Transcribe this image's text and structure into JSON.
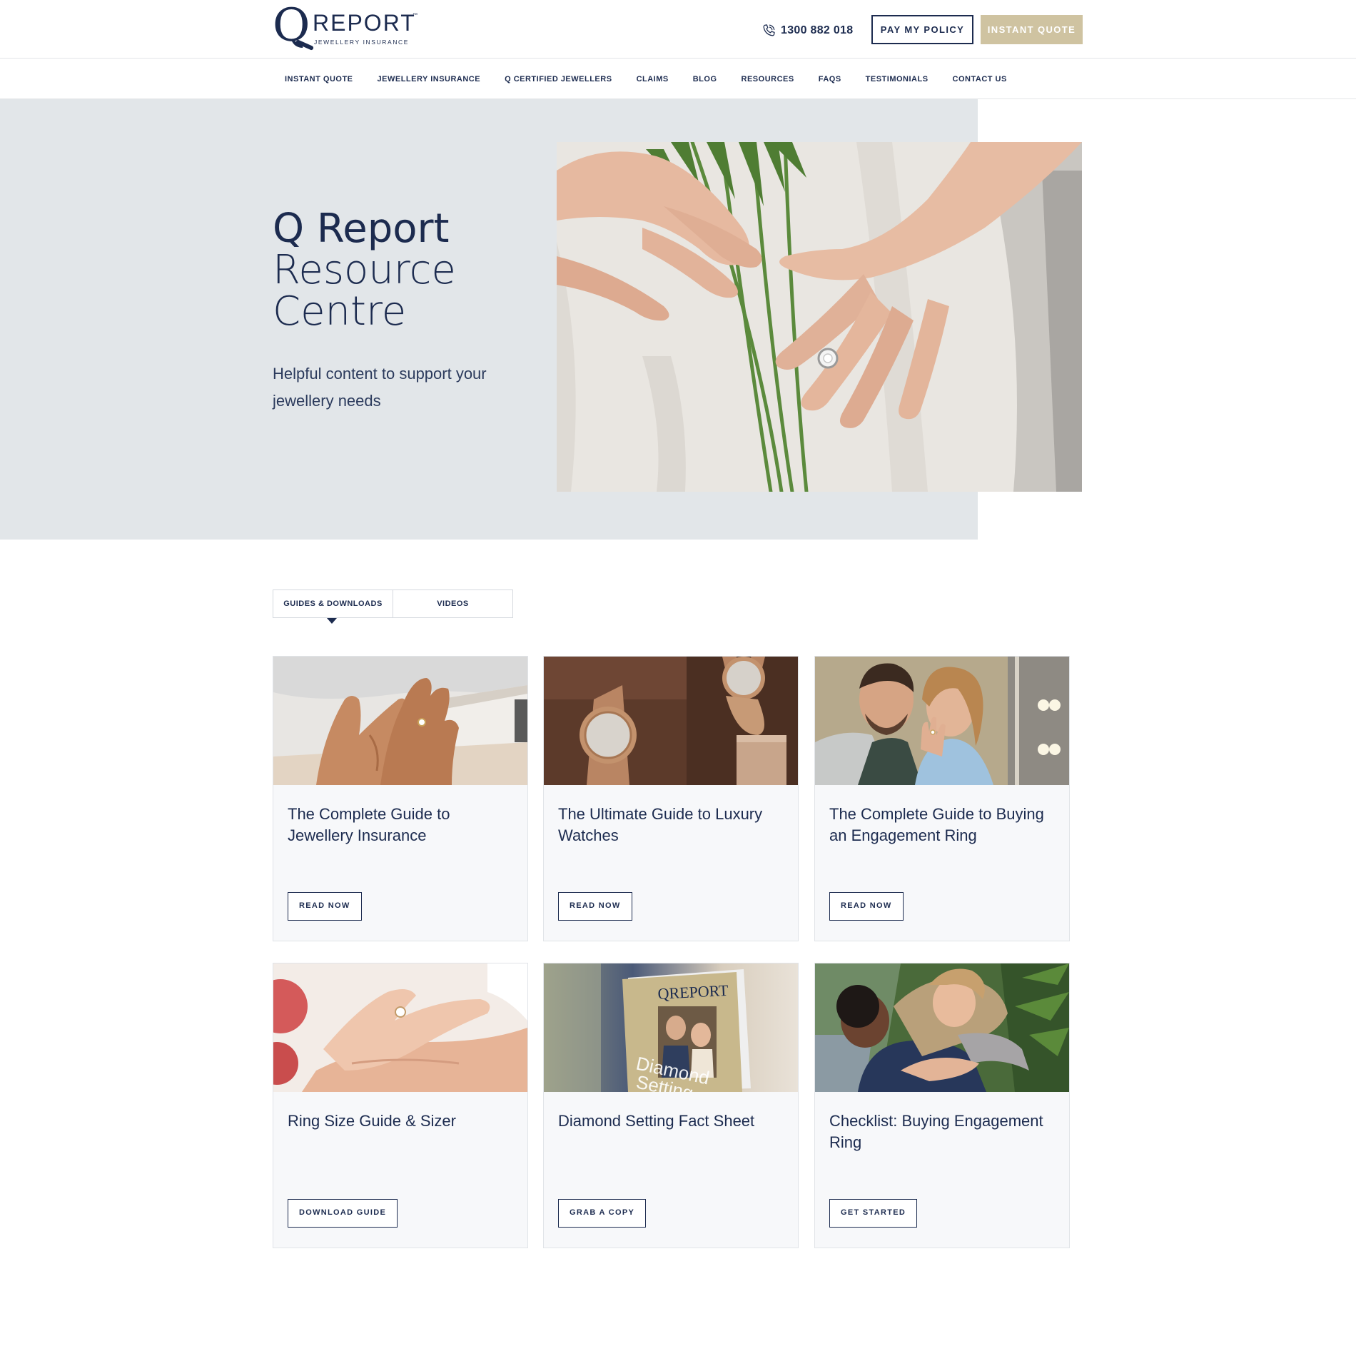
{
  "brand": {
    "logo_letter": "Q",
    "logo_word": "REPORT",
    "logo_tm": "™",
    "logo_sub": "JEWELLERY INSURANCE",
    "navy": "#1c2b4f",
    "gold": "#cfc3a1",
    "hero_bg": "#e2e6e9"
  },
  "header": {
    "phone": "1300 882 018",
    "phone_icon": "phone-icon",
    "pay_label": "PAY MY POLICY",
    "quote_label": "INSTANT QUOTE"
  },
  "nav": {
    "items": [
      "INSTANT QUOTE",
      "JEWELLERY INSURANCE",
      "Q CERTIFIED JEWELLERS",
      "CLAIMS",
      "BLOG",
      "RESOURCES",
      "FAQS",
      "TESTIMONIALS",
      "CONTACT US"
    ]
  },
  "hero": {
    "title_line1": "Q Report",
    "title_line2": "Resource",
    "title_line3": "Centre",
    "subtitle": "Helpful content to support your jewellery needs"
  },
  "tabs": {
    "items": [
      "GUIDES & DOWNLOADS",
      "VIDEOS"
    ],
    "active": "GUIDES & DOWNLOADS"
  },
  "cards": [
    {
      "title": "The Complete Guide to Jewellery Insurance",
      "button": "READ NOW"
    },
    {
      "title": "The Ultimate Guide to Luxury Watches",
      "button": "READ NOW"
    },
    {
      "title": "The Complete Guide to Buying an Engagement Ring",
      "button": "READ NOW"
    },
    {
      "title": "Ring Size Guide & Sizer",
      "button": "DOWNLOAD GUIDE"
    },
    {
      "title": "Diamond Setting Fact Sheet",
      "button": "GRAB A COPY"
    },
    {
      "title": "Checklist: Buying Engagement Ring",
      "button": "GET STARTED"
    }
  ],
  "booklet": {
    "brand": "QREPORT",
    "cover_text_1": "Diamond",
    "cover_text_2": "Setting"
  }
}
